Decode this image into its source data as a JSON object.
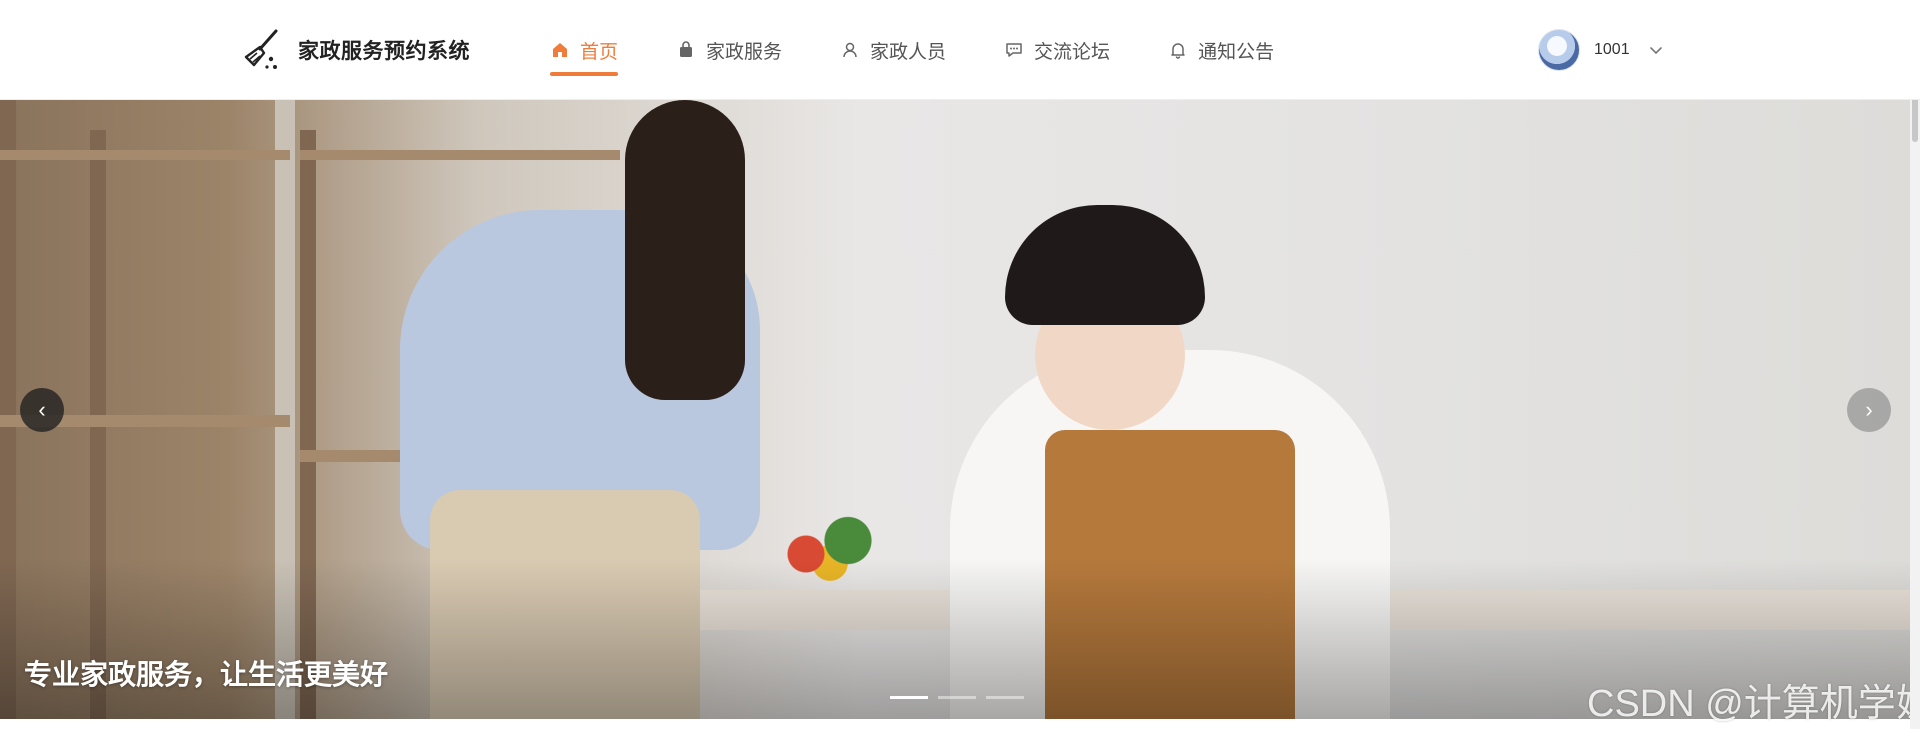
{
  "brand": {
    "title": "家政服务预约系统",
    "icon": "broom-icon"
  },
  "nav": {
    "items": [
      {
        "label": "首页",
        "icon": "home-icon",
        "active": true
      },
      {
        "label": "家政服务",
        "icon": "bag-icon",
        "active": false
      },
      {
        "label": "家政人员",
        "icon": "person-icon",
        "active": false
      },
      {
        "label": "交流论坛",
        "icon": "chat-icon",
        "active": false
      },
      {
        "label": "通知公告",
        "icon": "bell-icon",
        "active": false
      }
    ]
  },
  "user": {
    "name": "1001",
    "icon": "chevron-down-icon"
  },
  "banner": {
    "caption": "专业家政服务，让生活更美好",
    "prev_icon": "chevron-left-icon",
    "next_icon": "chevron-right-icon",
    "slides": 3,
    "active_slide": 1
  },
  "watermark": "CSDN @计算机学姐",
  "colors": {
    "accent": "#f07c3c",
    "text": "#555555",
    "brand_text": "#222222"
  }
}
